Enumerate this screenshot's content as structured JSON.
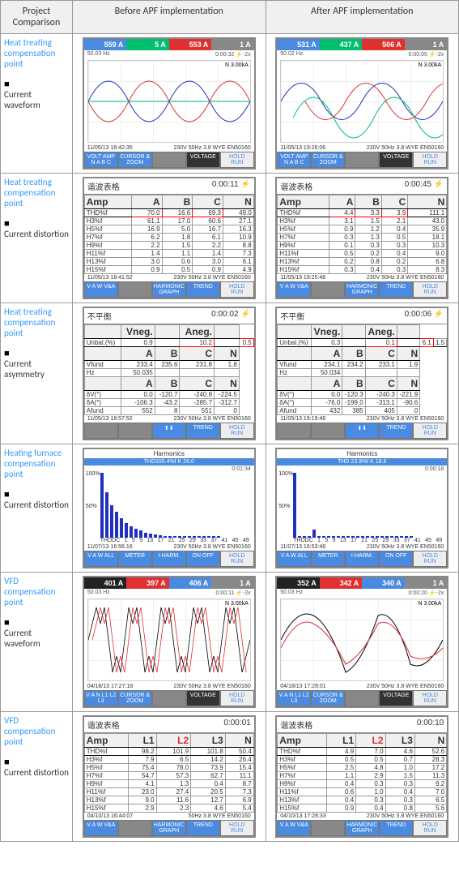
{
  "header": {
    "col0": "Project Comparison",
    "col1": "Before APF implementation",
    "col2": "After APF implementation"
  },
  "rows": {
    "r1": {
      "point": "Heat treating compensation point",
      "item": "Current waveform"
    },
    "r2": {
      "point": "Heat treating compensation point",
      "item": "Current distortion"
    },
    "r3": {
      "point": "Heat treating compensation point",
      "item": "Current asymmetry"
    },
    "r4": {
      "point": "Heating furnace compensation point",
      "item": "Current distortion"
    },
    "r5": {
      "point": "VFD compensation point",
      "item": "Current waveform"
    },
    "r6": {
      "point": "VFD compensation point",
      "item": "Current distortion"
    }
  },
  "meter_common": {
    "n_label": "N 3.00kA",
    "footer_volt": "VOLT AMP\nN A B C",
    "footer_cursor": "CURSOR\n& ZOOM",
    "footer_voltage": "VOLTAGE",
    "footer_hold": "HOLD",
    "footer_run": "RUN",
    "footer_harm": "HARMONIC\nGRAPH",
    "footer_trend": "TREND",
    "footer_meter": "METER",
    "footer_iharm": "I-HARM.",
    "footer_onoff": "ON OFF",
    "footer_van": "V A N\nL1 L2 L3",
    "footer_vaw": "V A W\nV&A",
    "footer_vaw2": "V A W\nALL"
  },
  "wave": {
    "before": {
      "seg": [
        "559 A",
        "5 A",
        "553 A",
        "1 A"
      ],
      "status_l": "50.03 Hz",
      "status_r": "0:00:32  ⚡-2x",
      "ts": "11/05/13 18:42:35",
      "ts_r": "230V 50Hz 3.8 WYE     EN50160"
    },
    "after": {
      "seg": [
        "531 A",
        "437 A",
        "506 A",
        "1 A"
      ],
      "status_l": "50.02 Hz",
      "status_r": "0:00:05  ⚡-2x",
      "ts": "11/05/13 19:26:06",
      "ts_r": "230V 50Hz 3.8 WYE     EN50160"
    }
  },
  "dist1": {
    "title": "谐波表格",
    "cols": [
      "Amp",
      "A",
      "B",
      "C",
      "N"
    ],
    "before": {
      "status_r": "0:00:11  ⚡",
      "rows": [
        [
          "THD%f",
          "70.0",
          "16.6",
          "69.3",
          "49.0"
        ],
        [
          "H3%f",
          "61.1",
          "17.0",
          "60.6",
          "27.1"
        ],
        [
          "H5%f",
          "16.9",
          "5.0",
          "16.7",
          "16.3"
        ],
        [
          "H7%f",
          "6.2",
          "1.8",
          "6.1",
          "10.9"
        ],
        [
          "H9%f",
          "2.2",
          "1.5",
          "2.2",
          "8.8"
        ],
        [
          "H11%f",
          "1.4",
          "1.1",
          "1.4",
          "7.3"
        ],
        [
          "H13%f",
          "3.0",
          "0.6",
          "3.0",
          "6.1"
        ],
        [
          "H15%f",
          "0.9",
          "0.5",
          "0.9",
          "4.9"
        ]
      ],
      "ts": "11/05/13 18:41:52",
      "ts_r": "230V 50Hz 3.8 WYE     EN50160"
    },
    "after": {
      "status_r": "0:00:45  ⚡",
      "rows": [
        [
          "THD%f",
          "4.4",
          "3.3",
          "3.9",
          "111.1"
        ],
        [
          "H3%f",
          "3.1",
          "1.5",
          "2.1",
          "43.0"
        ],
        [
          "H5%f",
          "0.9",
          "1.2",
          "0.4",
          "35.9"
        ],
        [
          "H7%f",
          "0.3",
          "1.3",
          "0.5",
          "18.1"
        ],
        [
          "H9%f",
          "0.1",
          "0.3",
          "0.3",
          "10.3"
        ],
        [
          "H11%f",
          "0.5",
          "0.2",
          "0.4",
          "9.0"
        ],
        [
          "H13%f",
          "0.2",
          "0.8",
          "0.2",
          "6.8"
        ],
        [
          "H15%f",
          "0.3",
          "0.4",
          "0.3",
          "8.3"
        ]
      ],
      "ts": "11/05/13 19:25:48",
      "ts_r": "230V 50Hz 3.8 WYE     EN50160"
    }
  },
  "asym": {
    "title": "不平衡",
    "head1": [
      "",
      "Vneg.",
      "",
      "Aneg.",
      ""
    ],
    "before": {
      "status_r": "0:00:02  ⚡",
      "r1": [
        "Unbal.(%)",
        "0.9",
        "",
        "10.2",
        "",
        "0.5"
      ],
      "cols2": [
        "",
        "A",
        "B",
        "C",
        "N"
      ],
      "r2": [
        "Vfund",
        "233.4",
        "235.6",
        "231.8",
        "1.8"
      ],
      "r3": [
        "Hz",
        "50.035",
        "",
        "",
        ""
      ],
      "r4": [
        "δV(°)",
        "0.0",
        "-120.7",
        "-240.8",
        "-224.5"
      ],
      "r5": [
        "δA(°)",
        "-106.3",
        "-43.2",
        "-285.7",
        "-312.7"
      ],
      "r6": [
        "Afund",
        "552",
        "8",
        "551",
        "0"
      ],
      "ts": "11/05/13 18:57:52",
      "ts_r": "230V 50Hz 3.8 WYE     EN50160"
    },
    "after": {
      "status_r": "0:00:06  ⚡",
      "r1": [
        "Unbal.(%)",
        "0.3",
        "",
        "0.1",
        "",
        "6.1",
        "1.5"
      ],
      "cols2": [
        "",
        "A",
        "B",
        "C",
        "N"
      ],
      "r2": [
        "Vfund",
        "234.1",
        "234.2",
        "233.1",
        "1.9"
      ],
      "r3": [
        "Hz",
        "50.034",
        "",
        "",
        ""
      ],
      "r4": [
        "δV(°)",
        "0.0",
        "-120.3",
        "-240.3",
        "-221.9"
      ],
      "r5": [
        "δA(°)",
        "-76.0",
        "-199.0",
        "-313.1",
        "-90.6"
      ],
      "r6": [
        "Afund",
        "432",
        "385",
        "405",
        "0"
      ],
      "ts": "11/05/13 19:19:48",
      "ts_r": "230V 50Hz 3.8 WYE     EN50160"
    }
  },
  "furnace": {
    "before": {
      "head": "Harmonics",
      "thd": "THD155.4%f   K    26.0",
      "ts": "11/07/13 16:56:16",
      "ts_r": "230V 50Hz 3.8 WYE     EN50160",
      "status_r": "0:01:34",
      "bars": [
        100,
        70,
        50,
        40,
        30,
        22,
        18,
        14,
        11,
        8,
        6,
        5,
        4,
        3,
        2,
        2,
        2,
        2,
        2,
        2,
        2,
        2,
        2,
        2,
        2
      ]
    },
    "after": {
      "head": "Harmonics",
      "thd": "THD 23.9%f   K     18.6",
      "ts": "11/07/13 16:53:48",
      "ts_r": "230V 50Hz 3.8 WYE     EN50160",
      "status_r": "0:00:18",
      "bars": [
        100,
        3,
        2,
        2,
        12,
        2,
        2,
        2,
        2,
        2,
        2,
        2,
        2,
        2,
        2,
        2,
        2,
        2,
        2,
        2,
        2,
        2,
        2,
        2,
        2
      ]
    }
  },
  "vfd_wave": {
    "before": {
      "seg": [
        "401 A",
        "397 A",
        "406 A",
        "1 A"
      ],
      "status_l": "50.03 Hz",
      "status_r": "0:00:11  ⚡-2x",
      "ts": "04/18/13 17:27:18",
      "ts_r": "230V 50Hz 3.8 WYE     EN50160"
    },
    "after": {
      "seg": [
        "352 A",
        "342 A",
        "340 A",
        "1 A"
      ],
      "status_l": "50.03 Hz",
      "status_r": "0:00:20  ⚡-2x",
      "ts": "04/18/13 17:28:01",
      "ts_r": "230V 50Hz 3.8 WYE     EN50160"
    }
  },
  "vfd_dist": {
    "cols": [
      "Amp",
      "L1",
      "L2",
      "L3",
      "N"
    ],
    "before": {
      "status_r": "0:00:01",
      "rows": [
        [
          "THD%f",
          "98.2",
          "101.9",
          "101.8",
          "50.4"
        ],
        [
          "H3%f",
          "7.9",
          "6.5",
          "14.2",
          "26.4"
        ],
        [
          "H5%f",
          "75.4",
          "78.0",
          "73.9",
          "15.4"
        ],
        [
          "H7%f",
          "54.7",
          "57.3",
          "62.7",
          "11.1"
        ],
        [
          "H9%f",
          "4.1",
          "1.3",
          "0.4",
          "8.7"
        ],
        [
          "H11%f",
          "23.0",
          "27.4",
          "20.5",
          "7.3"
        ],
        [
          "H13%f",
          "9.0",
          "11.6",
          "12.7",
          "6.9"
        ],
        [
          "H15%f",
          "2.9",
          "2.3",
          "4.6",
          "5.4"
        ]
      ],
      "ts": "04/10/13 16:44:07",
      "ts_r": "50Hz 3.8 WYE     EN50160"
    },
    "after": {
      "status_r": "0:00:10",
      "rows": [
        [
          "THD%f",
          "4.9",
          "7.0",
          "4.6",
          "52.6"
        ],
        [
          "H3%f",
          "0.5",
          "0.5",
          "0.7",
          "28.3"
        ],
        [
          "H5%f",
          "2.5",
          "4.8",
          "1.0",
          "17.2"
        ],
        [
          "H7%f",
          "1.1",
          "2.9",
          "1.5",
          "11.3"
        ],
        [
          "H9%f",
          "0.4",
          "0.3",
          "0.3",
          "9.2"
        ],
        [
          "H11%f",
          "0.6",
          "1.0",
          "0.4",
          "7.0"
        ],
        [
          "H13%f",
          "0.4",
          "0.3",
          "0.3",
          "6.5"
        ],
        [
          "H15%f",
          "0.9",
          "0.4",
          "0.8",
          "5.6"
        ]
      ],
      "ts": "04/10/13 17:28:33",
      "ts_r": "230V 50Hz 3.8 WYE     EN50160"
    }
  },
  "chart_data": [
    {
      "type": "bar",
      "title": "Harmonics THD155.4%f K 26.0 (before)",
      "categories": [
        "THDDC",
        "1",
        "5",
        "9",
        "13",
        "17",
        "21",
        "25",
        "29",
        "33",
        "37",
        "41",
        "45",
        "49"
      ],
      "values": [
        100,
        70,
        50,
        40,
        30,
        22,
        18,
        14,
        11,
        8,
        6,
        5,
        4,
        3
      ],
      "ylabel": "%",
      "ylim": [
        0,
        100
      ]
    },
    {
      "type": "bar",
      "title": "Harmonics THD 23.9%f K 18.6 (after)",
      "categories": [
        "THDDC",
        "1",
        "5",
        "9",
        "13",
        "17",
        "21",
        "25",
        "29",
        "33",
        "37",
        "41",
        "45",
        "49"
      ],
      "values": [
        100,
        3,
        2,
        2,
        12,
        2,
        2,
        2,
        2,
        2,
        2,
        2,
        2,
        2
      ],
      "ylabel": "%",
      "ylim": [
        0,
        100
      ]
    },
    {
      "type": "line",
      "title": "Heat treating current waveform before",
      "series": [
        {
          "name": "A",
          "color": "blue"
        },
        {
          "name": "B",
          "color": "green"
        },
        {
          "name": "C",
          "color": "red"
        },
        {
          "name": "N",
          "color": "gray"
        }
      ],
      "note": "sine waves ~50Hz overlapping, A and C large amplitude, B flat"
    },
    {
      "type": "line",
      "title": "Heat treating current waveform after",
      "series": [
        {
          "name": "A",
          "color": "blue"
        },
        {
          "name": "B",
          "color": "green"
        },
        {
          "name": "C",
          "color": "red"
        },
        {
          "name": "N",
          "color": "gray"
        }
      ],
      "note": "three clean sine waves ~120° apart"
    },
    {
      "type": "line",
      "title": "VFD current waveform before",
      "series": [
        {
          "name": "L1",
          "color": "black"
        },
        {
          "name": "L2",
          "color": "red"
        },
        {
          "name": "L3",
          "color": "blue"
        }
      ],
      "note": "spiky double-peak distorted sine"
    },
    {
      "type": "line",
      "title": "VFD current waveform after",
      "series": [
        {
          "name": "L1",
          "color": "black"
        },
        {
          "name": "L2",
          "color": "red"
        },
        {
          "name": "L3",
          "color": "blue"
        }
      ],
      "note": "smoothed flat-top sine"
    }
  ]
}
